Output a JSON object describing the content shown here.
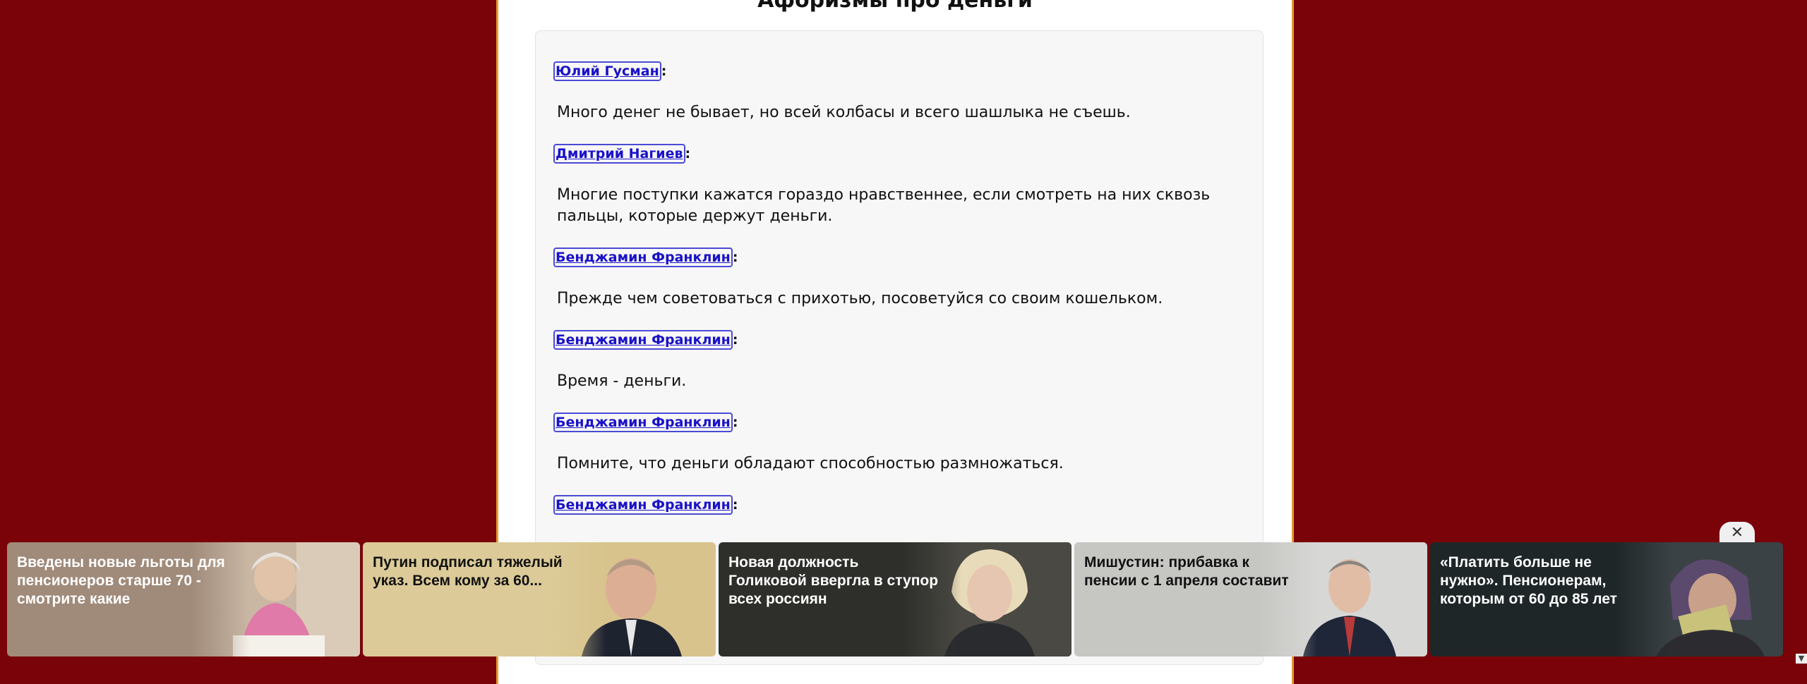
{
  "page": {
    "title": "Афоризмы про деньги"
  },
  "quotes": [
    {
      "author": "Юлий Гусман",
      "text": "Много денег не бывает, но всей колбасы и всего шашлыка не съешь."
    },
    {
      "author": "Дмитрий Нагиев",
      "text": "Многие поступки кажатся гораздо нравственнее, если смотреть на них сквозь пальцы, которые держут деньги."
    },
    {
      "author": "Бенджамин Франклин",
      "text": "Прежде чем советоваться с прихотью, посоветуйся со своим кошельком."
    },
    {
      "author": "Бенджамин Франклин",
      "text": "Время - деньги."
    },
    {
      "author": "Бенджамин Франклин",
      "text": "Помните, что деньги обладают способностью размножаться."
    },
    {
      "author": "Бенджамин Франклин",
      "text": ""
    }
  ],
  "separator": ":",
  "ads": [
    {
      "text": "Введены новые льготы для пенсионеров старше 70 - смотрите какие",
      "bg": "#a08a7a",
      "text_color": "#ffffff",
      "icon": "elderly-woman-photo"
    },
    {
      "text": "Путин подписал тяжелый указ. Всем кому за 60...",
      "bg": "#dccb98",
      "text_color": "#111111",
      "icon": "president-photo"
    },
    {
      "text": "Новая должность Голиковой ввергла в ступор всех россиян",
      "bg": "#2e2e2a",
      "text_color": "#ffffff",
      "icon": "official-woman-photo"
    },
    {
      "text": "Мишустин: прибавка к пенсии с 1 апреля составит",
      "bg": "#c6c6c3",
      "text_color": "#111111",
      "icon": "prime-minister-photo"
    },
    {
      "text": "«Платить больше не нужно». Пенсионерам, которым от 60 до 85 лет",
      "bg": "#1f2628",
      "text_color": "#ffffff",
      "icon": "elderly-woman-money-photo"
    }
  ],
  "ad_close": "✕",
  "scroll_down": "▼"
}
